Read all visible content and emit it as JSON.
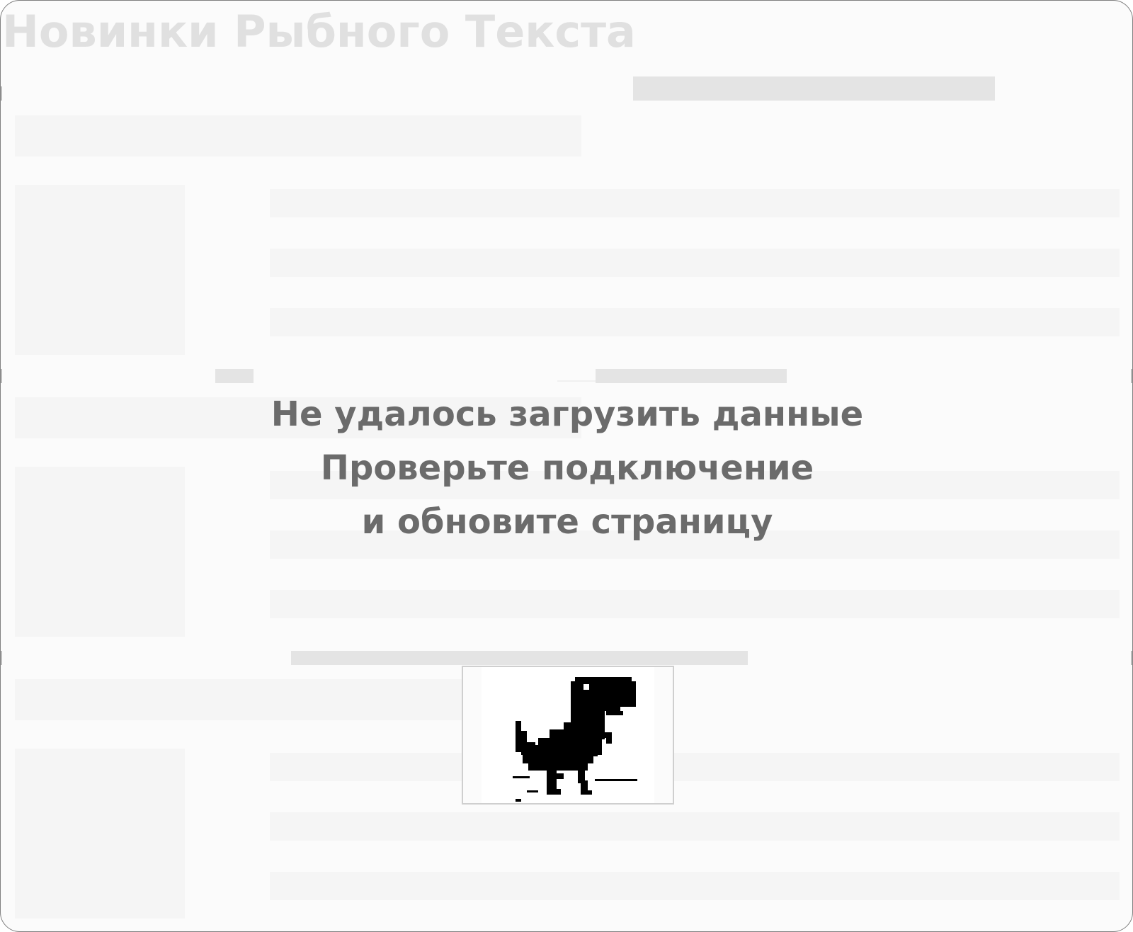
{
  "page": {
    "title": "Новинки Рыбного Текста"
  },
  "error": {
    "line1": "Не удалось загрузить данные",
    "line2": "Проверьте подключение",
    "line3": "и обновите страницу"
  },
  "icons": {
    "dino": "offline-dino-icon"
  },
  "colors": {
    "title": "#e0e0e0",
    "error_text": "#6b6b6b",
    "placeholder_dark": "#e4e4e4",
    "placeholder_light": "#f5f5f5",
    "background": "#fbfbfb"
  }
}
